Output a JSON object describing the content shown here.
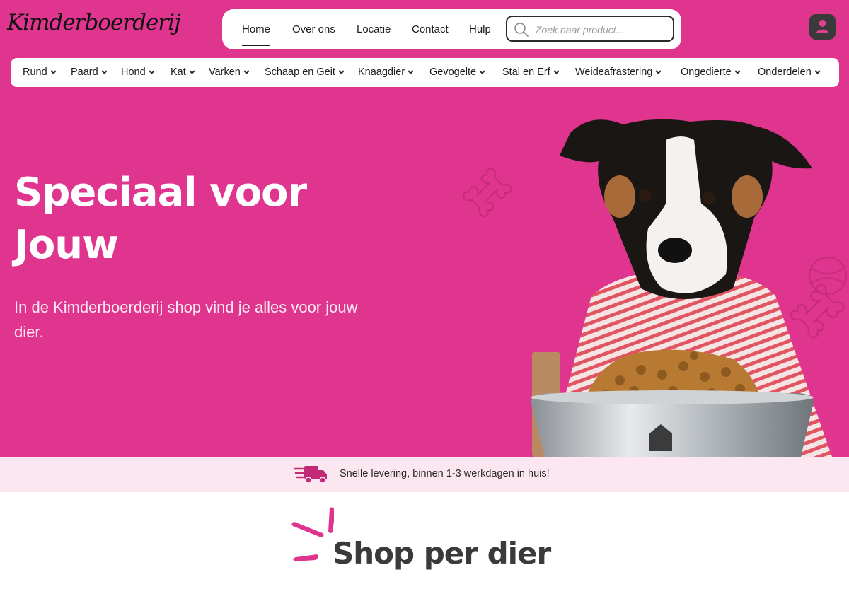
{
  "brand": {
    "logo_text": "Kimderboerderij"
  },
  "top_nav": {
    "items": [
      {
        "label": "Home",
        "active": true
      },
      {
        "label": "Over ons"
      },
      {
        "label": "Locatie"
      },
      {
        "label": "Contact"
      },
      {
        "label": "Hulp"
      }
    ]
  },
  "search": {
    "placeholder": "Zoek naar product..."
  },
  "categories": [
    "Rund",
    "Paard",
    "Hond",
    "Kat",
    "Varken",
    "Schaap en Geit",
    "Knaagdier",
    "Gevogelte",
    "Stal en Erf",
    "Weideafrastering",
    "Ongedierte",
    "Onderdelen"
  ],
  "hero": {
    "title": "Speciaal voor Jouw",
    "subtitle": "In de Kimderboerderij shop vind je alles voor jouw dier."
  },
  "delivery": {
    "text": "Snelle levering, binnen 1-3 werkdagen in huis!"
  },
  "section": {
    "title": "Shop per dier"
  },
  "colors": {
    "brand_pink": "#df358f",
    "light_pink": "#fce7f1",
    "dark": "#3a3a3a"
  }
}
